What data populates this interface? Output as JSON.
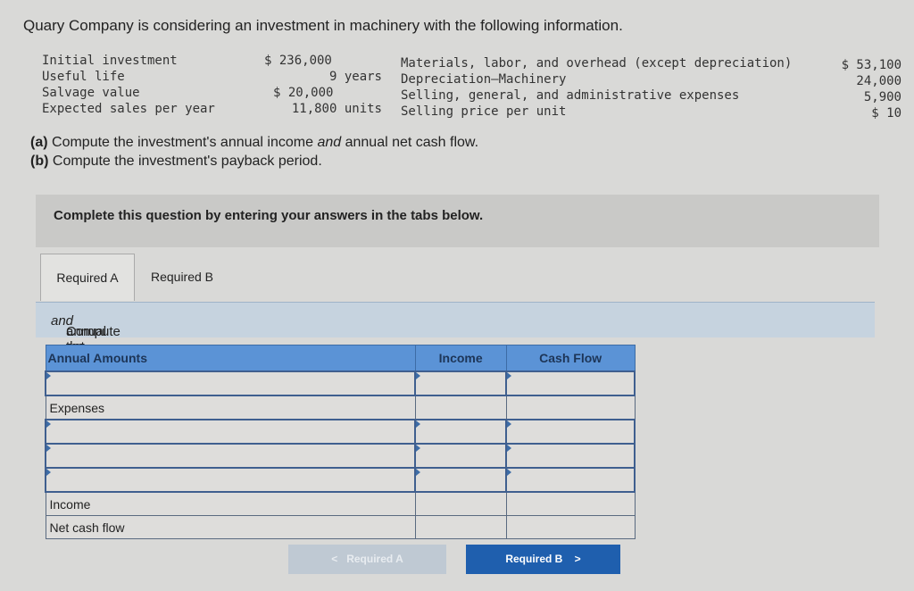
{
  "title": "Quary Company is considering an investment in machinery with the following information.",
  "info_left": [
    {
      "label": "Initial investment",
      "value": "$ 236,000"
    },
    {
      "label": "Useful life",
      "value": "9 years"
    },
    {
      "label": "Salvage value",
      "value": "$ 20,000"
    },
    {
      "label": "Expected sales per year",
      "value": "11,800 units"
    }
  ],
  "info_right": [
    {
      "label": "Materials, labor, and overhead (except depreciation)",
      "value": "$ 53,100"
    },
    {
      "label": "Depreciation—Machinery",
      "value": "24,000"
    },
    {
      "label": "Selling, general, and administrative expenses",
      "value": "5,900"
    },
    {
      "label": "Selling price per unit",
      "value": "$ 10"
    }
  ],
  "questions": {
    "a_prefix": "(a)",
    "a_text": " Compute the investment's annual income ",
    "a_em": "and",
    "a_end": " annual net cash flow.",
    "b_prefix": "(b)",
    "b_text": " Compute the investment's payback period."
  },
  "instruction": "Complete this question by entering your answers in the tabs below.",
  "tabs": [
    "Required A",
    "Required B"
  ],
  "subtitle": {
    "pre": "Compute the investment's annual income ",
    "em": "and",
    "post": " annual net cash flow."
  },
  "table": {
    "headers": [
      "Annual Amounts",
      "Income",
      "Cash Flow"
    ],
    "rows": [
      {
        "label": "",
        "input": true
      },
      {
        "label": "Expenses",
        "input": false
      },
      {
        "label": "",
        "input": true
      },
      {
        "label": "",
        "input": true
      },
      {
        "label": "",
        "input": true
      },
      {
        "label": "Income",
        "input": false
      },
      {
        "label": "Net cash flow",
        "input": false
      }
    ]
  },
  "buttons": {
    "prev": "Required A",
    "next": "Required B"
  }
}
